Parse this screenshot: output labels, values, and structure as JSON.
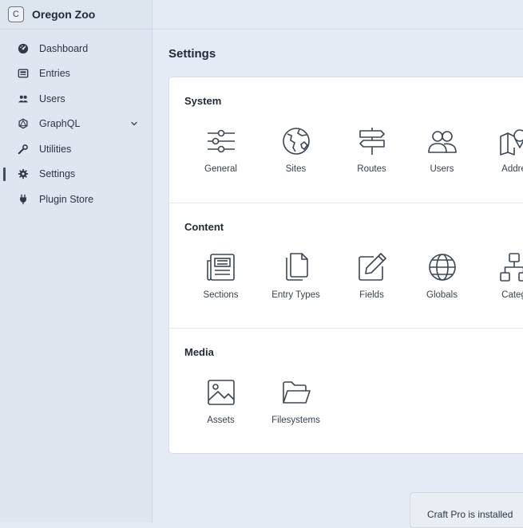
{
  "site": {
    "badge": "C",
    "name": "Oregon Zoo"
  },
  "nav": [
    {
      "label": "Dashboard",
      "icon": "dashboard-gauge-icon"
    },
    {
      "label": "Entries",
      "icon": "newspaper-icon"
    },
    {
      "label": "Users",
      "icon": "users-icon"
    },
    {
      "label": "GraphQL",
      "icon": "graphql-icon",
      "has_submenu": true
    },
    {
      "label": "Utilities",
      "icon": "wrench-icon"
    },
    {
      "label": "Settings",
      "icon": "gear-icon",
      "active": true
    },
    {
      "label": "Plugin Store",
      "icon": "plug-icon"
    }
  ],
  "page": {
    "title": "Settings"
  },
  "sections": [
    {
      "title": "System",
      "items": [
        {
          "label": "General",
          "icon": "sliders-icon"
        },
        {
          "label": "Sites",
          "icon": "globe-icon"
        },
        {
          "label": "Routes",
          "icon": "signpost-icon"
        },
        {
          "label": "Users",
          "icon": "users-icon"
        },
        {
          "label": "Addre",
          "icon": "map-icon"
        }
      ]
    },
    {
      "title": "Content",
      "items": [
        {
          "label": "Sections",
          "icon": "newspaper-icon"
        },
        {
          "label": "Entry Types",
          "icon": "files-icon"
        },
        {
          "label": "Fields",
          "icon": "pen-square-icon"
        },
        {
          "label": "Globals",
          "icon": "globe-grid-icon"
        },
        {
          "label": "Categ",
          "icon": "sitemap-icon"
        }
      ]
    },
    {
      "title": "Media",
      "items": [
        {
          "label": "Assets",
          "icon": "image-icon"
        },
        {
          "label": "Filesystems",
          "icon": "folder-open-icon"
        }
      ]
    }
  ],
  "toast": {
    "text": "Craft Pro is installed"
  },
  "colors": {
    "background": "#e4ebf4",
    "sidebar": "#dfe6ef",
    "panel": "#ffffff",
    "text": "#1f2a37",
    "icon_stroke": "#3b4654"
  }
}
